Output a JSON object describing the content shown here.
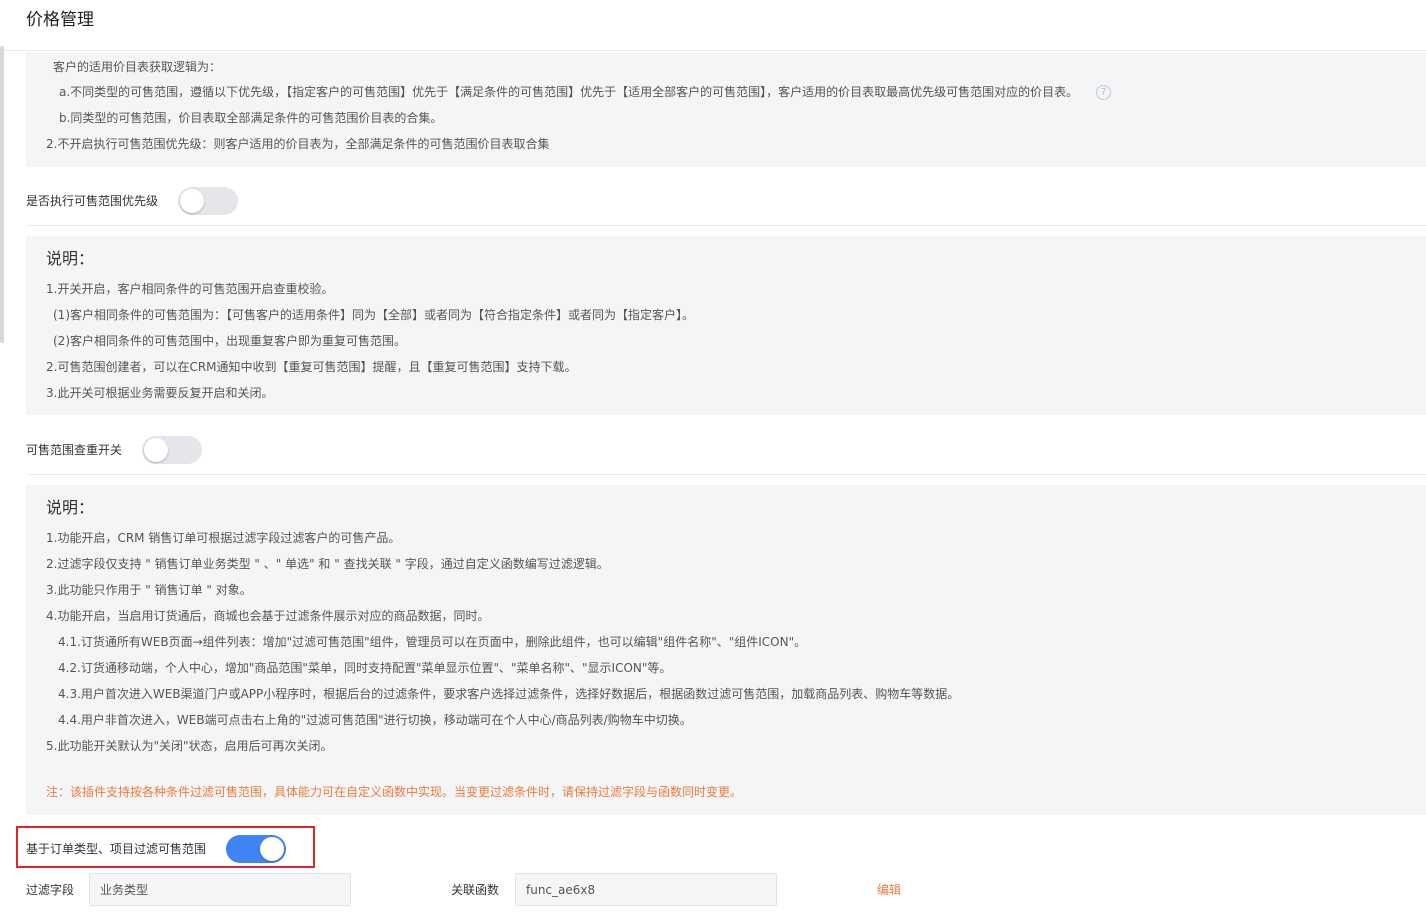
{
  "page": {
    "title": "价格管理"
  },
  "priority_rules": {
    "lines": [
      "客户的适用价目表获取逻辑为：",
      "a.不同类型的可售范围，遵循以下优先级，【指定客户的可售范围】优先于【满足条件的可售范围】优先于【适用全部客户的可售范围】，客户适用的价目表取最高优先级可售范围对应的价目表。",
      "b.同类型的可售范围，价目表取全部满足条件的可售范围价目表的合集。",
      "2.不开启执行可售范围优先级：则客户适用的价目表为，全部满足条件的可售范围价目表取合集"
    ],
    "help_glyph": "?"
  },
  "priority_setting": {
    "label": "是否执行可售范围优先级",
    "enabled": false
  },
  "dedupe_desc": {
    "heading": "说明：",
    "lines": [
      "1.开关开启，客户相同条件的可售范围开启查重校验。",
      "(1)客户相同条件的可售范围为：【可售客户的适用条件】同为【全部】或者同为【符合指定条件】或者同为【指定客户】。",
      "(2)客户相同条件的可售范围中，出现重复客户即为重复可售范围。",
      "2.可售范围创建者，可以在CRM通知中收到【重复可售范围】提醒，且【重复可售范围】支持下载。",
      "3.此开关可根据业务需要反复开启和关闭。"
    ]
  },
  "dedupe_setting": {
    "label": "可售范围查重开关",
    "enabled": false
  },
  "filter_desc": {
    "heading": "说明：",
    "lines": [
      "1.功能开启，CRM 销售订单可根据过滤字段过滤客户的可售产品。",
      "2.过滤字段仅支持 \" 销售订单业务类型 \" 、\" 单选\" 和 \" 查找关联 \" 字段，通过自定义函数编写过滤逻辑。",
      "3.此功能只作用于 \" 销售订单 \" 对象。",
      "4.功能开启，当启用订货通后，商城也会基于过滤条件展示对应的商品数据，同时。",
      "4.1.订货通所有WEB页面→组件列表：增加\"过滤可售范围\"组件，管理员可以在页面中，删除此组件，也可以编辑\"组件名称\"、\"组件ICON\"。",
      "4.2.订货通移动端，个人中心，增加\"商品范围\"菜单，同时支持配置\"菜单显示位置\"、\"菜单名称\"、\"显示ICON\"等。",
      "4.3.用户首次进入WEB渠道门户或APP小程序时，根据后台的过滤条件，要求客户选择过滤条件，选择好数据后，根据函数过滤可售范围，加载商品列表、购物车等数据。",
      "4.4.用户非首次进入，WEB端可点击右上角的\"过滤可售范围\"进行切换，移动端可在个人中心/商品列表/购物车中切换。",
      "5.此功能开关默认为\"关闭\"状态，启用后可再次关闭。"
    ],
    "note": "注：该插件支持按各种条件过滤可售范围，具体能力可在自定义函数中实现。当变更过滤条件时，请保持过滤字段与函数同时变更。",
    "note_color": "#ef7a3d"
  },
  "filter_setting": {
    "label": "基于订单类型、项目过滤可售范围",
    "enabled": true,
    "accent": "#3f84f5",
    "highlight_color": "#e0262b"
  },
  "filter_fields": {
    "field_label": "过滤字段",
    "field_value": "业务类型",
    "func_label": "关联函数",
    "func_value": "func_ae6x8",
    "edit_label": "编辑"
  }
}
